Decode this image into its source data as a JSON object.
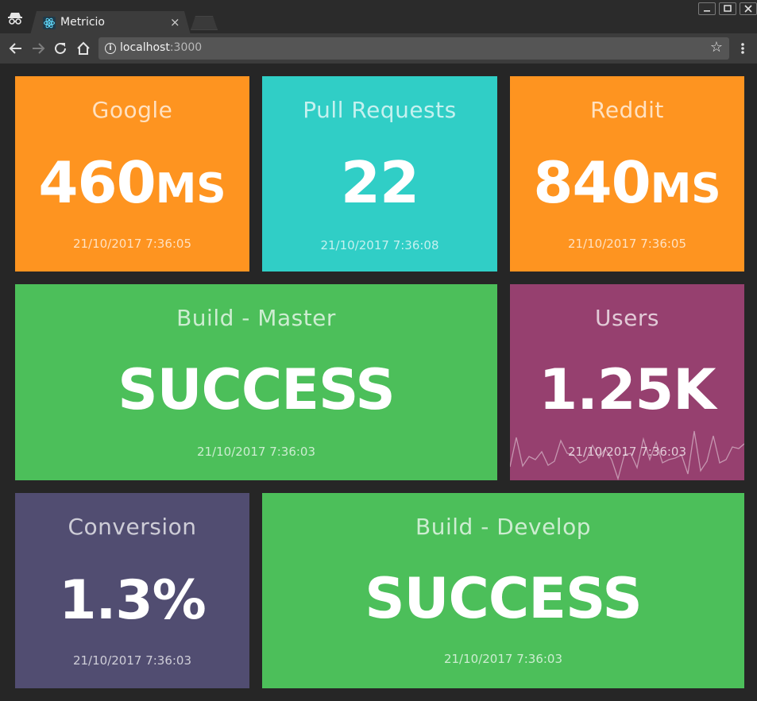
{
  "browser": {
    "tab_title": "Metricio",
    "tab_close": "×",
    "url_host": "localhost",
    "url_port": ":3000",
    "icons": [
      "incognito-icon",
      "react-favicon-icon",
      "back-icon",
      "forward-icon",
      "reload-icon",
      "home-icon",
      "info-icon",
      "star-icon",
      "menu-icon",
      "minimize-icon",
      "maximize-icon",
      "close-icon"
    ]
  },
  "colors": {
    "orange": "#fe9420",
    "teal": "#30cec6",
    "green": "#4cbf5a",
    "plum": "#96406f",
    "slate": "#514d71"
  },
  "widgets": {
    "google": {
      "title": "Google",
      "value": "460",
      "unit": "MS",
      "time": "21/10/2017 7:36:05"
    },
    "pull_requests": {
      "title": "Pull Requests",
      "value": "22",
      "time": "21/10/2017 7:36:08"
    },
    "reddit": {
      "title": "Reddit",
      "value": "840",
      "unit": "MS",
      "time": "21/10/2017 7:36:05"
    },
    "build_master": {
      "title": "Build - Master",
      "value": "SUCCESS",
      "time": "21/10/2017 7:36:03"
    },
    "users": {
      "title": "Users",
      "value": "1.25K",
      "time": "21/10/2017 7:36:03"
    },
    "conversion": {
      "title": "Conversion",
      "value": "1.3%",
      "time": "21/10/2017 7:36:03"
    },
    "build_develop": {
      "title": "Build - Develop",
      "value": "SUCCESS",
      "time": "21/10/2017 7:36:03"
    }
  }
}
